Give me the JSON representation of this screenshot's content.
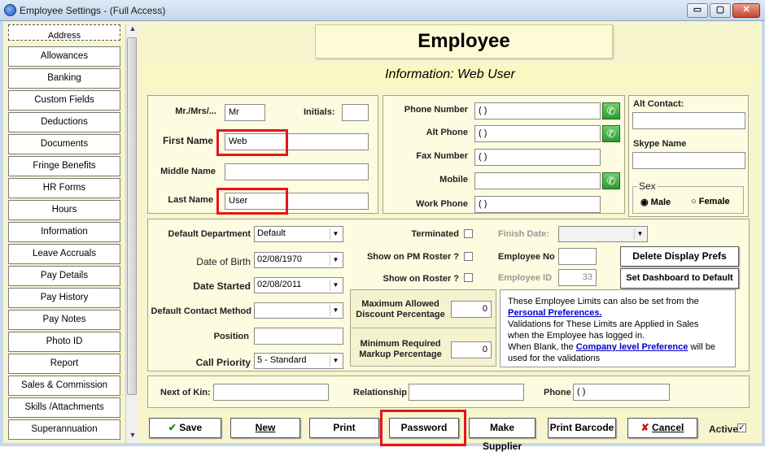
{
  "window": {
    "title": "Employee Settings - (Full Access)",
    "min": "▭",
    "max": "▢",
    "close": "✕"
  },
  "sidebar": {
    "items": [
      "Address",
      "Allowances",
      "Banking",
      "Custom Fields",
      "Deductions",
      "Documents",
      "Fringe Benefits",
      "HR Forms",
      "Hours",
      "Information",
      "Leave Accruals",
      "Pay Details",
      "Pay History",
      "Pay Notes",
      "Photo ID",
      "Report",
      "Sales & Commission",
      "Skills /Attachments",
      "Superannuation"
    ]
  },
  "header": {
    "title": "Employee",
    "subtitle": "Information: Web User"
  },
  "name": {
    "title_label": "Mr./Mrs/...",
    "title_value": "Mr",
    "initials_label": "Initials:",
    "initials_value": "",
    "first_label": "First Name",
    "first_value": "Web",
    "middle_label": "Middle Name",
    "middle_value": "",
    "last_label": "Last Name",
    "last_value": "User"
  },
  "contact": {
    "phone_label": "Phone Number",
    "phone_value": "(  )",
    "alt_label": "Alt Phone",
    "alt_value": "(  )",
    "fax_label": "Fax Number",
    "fax_value": "(  )",
    "mobile_label": "Mobile",
    "mobile_value": "",
    "work_label": "Work Phone",
    "work_value": "(  )",
    "altcontact_label": "Alt Contact:",
    "altcontact_value": "",
    "skype_label": "Skype Name",
    "skype_value": "",
    "sex_label": "Sex",
    "male": "Male",
    "female": "Female",
    "phone_icon": "✆"
  },
  "employment": {
    "dept_label": "Default Department",
    "dept_value": "Default",
    "dob_label": "Date of Birth",
    "dob_value": "02/08/1970",
    "started_label": "Date Started",
    "started_value": "02/08/2011",
    "method_label": "Default Contact Method",
    "method_value": "",
    "position_label": "Position",
    "position_value": "",
    "priority_label": "Call Priority",
    "priority_value": "5  - Standard",
    "terminated_label": "Terminated",
    "finish_label": "Finish Date:",
    "finish_value": "",
    "pmroster_label": "Show on PM Roster ?",
    "roster_label": "Show on Roster ?",
    "empno_label": "Employee No",
    "empno_value": "",
    "empid_label": "Employee ID",
    "empid_value": "33",
    "delete_prefs": "Delete Display Prefs",
    "set_dashboard": "Set Dashboard to Default"
  },
  "limits": {
    "max_label_1": "Maximum Allowed",
    "max_label_2": "Discount Percentage",
    "max_value": "0",
    "min_label_1": "Minimum Required",
    "min_label_2": "Markup Percentage",
    "min_value": "0",
    "note_1": "These Employee Limits can also be set from the",
    "note_link_1": "Personal Preferences.",
    "note_2": "Validations for These Limits are Applied in Sales",
    "note_3": "when the Employee has logged in.",
    "note_4": "When Blank, the ",
    "note_link_2": "Company level Preference",
    "note_5": " will be",
    "note_6": "used for the validations"
  },
  "kin": {
    "kin_label": "Next of Kin:",
    "kin_value": "",
    "rel_label": "Relationship",
    "rel_value": "",
    "phone_label": "Phone",
    "phone_value": "(  )"
  },
  "toolbar": {
    "save": "Save",
    "new": "New",
    "print": "Print",
    "password": "Password",
    "make_supplier": "Make Supplier",
    "print_barcode": "Print Barcode",
    "cancel": "Cancel",
    "active": "Active",
    "save_icon": "✔",
    "cancel_icon": "✘"
  },
  "colors": {
    "highlight": "#e2161c",
    "panel_bg": "#f6f5cd"
  }
}
